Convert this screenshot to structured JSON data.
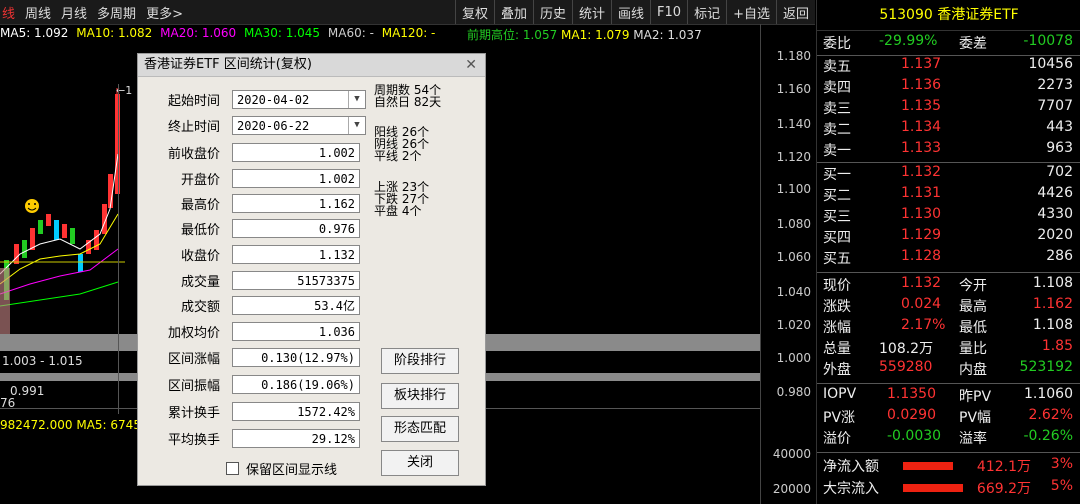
{
  "toolbar": {
    "left": [
      "线",
      "周线",
      "月线",
      "多周期",
      "更多>"
    ],
    "right": [
      "复权",
      "叠加",
      "历史",
      "统计",
      "画线",
      "F10",
      "标记",
      "+自选",
      "返回"
    ]
  },
  "ma": {
    "ma5": "MA5: 1.092",
    "ma10": "MA10: 1.082",
    "ma20": "MA20: 1.060",
    "ma30": "MA30: 1.045",
    "ma60": "MA60: -",
    "ma120": "MA120: -",
    "prev_high": "前期高位: 1.057",
    "ma1": "MA1: 1.079",
    "ma2": "MA2: 1.037"
  },
  "axis_ticks": [
    "1.180",
    "1.160",
    "1.140",
    "1.120",
    "1.100",
    "1.080",
    "1.060",
    "1.040",
    "1.020",
    "1.000",
    "0.980",
    "40000",
    "20000"
  ],
  "chart_labels": {
    "range": "1.003 - 1.015",
    "low": "0.991",
    "low2": "76",
    "vol": "982472.000",
    "vol_ma5": "MA5: 6745"
  },
  "dialog": {
    "title": "香港证券ETF 区间统计(复权)",
    "start_label": "起始时间",
    "start": "2020-04-02",
    "end_label": "终止时间",
    "end": "2020-06-22",
    "fields": [
      {
        "label": "前收盘价",
        "value": "1.002"
      },
      {
        "label": "开盘价",
        "value": "1.002"
      },
      {
        "label": "最高价",
        "value": "1.162"
      },
      {
        "label": "最低价",
        "value": "0.976"
      },
      {
        "label": "收盘价",
        "value": "1.132"
      },
      {
        "label": "成交量",
        "value": "51573375"
      },
      {
        "label": "成交额",
        "value": "53.4亿"
      },
      {
        "label": "加权均价",
        "value": "1.036"
      },
      {
        "label": "区间涨幅",
        "value": "0.130(12.97%)"
      },
      {
        "label": "区间振幅",
        "value": "0.186(19.06%)"
      },
      {
        "label": "累计换手",
        "value": "1572.42%"
      },
      {
        "label": "平均换手",
        "value": "29.12%"
      }
    ],
    "stats": {
      "periods": "周期数 54个",
      "natural_days": "自然日 82天",
      "yang": "阳线 26个",
      "yin": "阴线 26个",
      "flat_line": "平线 2个",
      "up": "上涨 23个",
      "down": "下跌 27个",
      "flat": "平盘 4个"
    },
    "buttons": [
      "阶段排行",
      "板块排行",
      "形态匹配",
      "关闭"
    ],
    "checkbox": "保留区间显示线"
  },
  "quote": {
    "header": "513090 香港证券ETF",
    "weibi_label": "委比",
    "weibi": "-29.99%",
    "weicha_label": "委差",
    "weicha": "-10078",
    "asks": [
      {
        "label": "卖五",
        "price": "1.137",
        "vol": "10456"
      },
      {
        "label": "卖四",
        "price": "1.136",
        "vol": "2273"
      },
      {
        "label": "卖三",
        "price": "1.135",
        "vol": "7707"
      },
      {
        "label": "卖二",
        "price": "1.134",
        "vol": "443"
      },
      {
        "label": "卖一",
        "price": "1.133",
        "vol": "963"
      }
    ],
    "bids": [
      {
        "label": "买一",
        "price": "1.132",
        "vol": "702"
      },
      {
        "label": "买二",
        "price": "1.131",
        "vol": "4426"
      },
      {
        "label": "买三",
        "price": "1.130",
        "vol": "4330"
      },
      {
        "label": "买四",
        "price": "1.129",
        "vol": "2020"
      },
      {
        "label": "买五",
        "price": "1.128",
        "vol": "286"
      }
    ],
    "info": [
      {
        "l1": "现价",
        "v1": "1.132",
        "c1": "red",
        "l2": "今开",
        "v2": "1.108",
        "c2": "wht"
      },
      {
        "l1": "涨跌",
        "v1": "0.024",
        "c1": "red",
        "l2": "最高",
        "v2": "1.162",
        "c2": "red"
      },
      {
        "l1": "涨幅",
        "v1": "2.17%",
        "c1": "red",
        "l2": "最低",
        "v2": "1.108",
        "c2": "wht"
      },
      {
        "l1": "总量",
        "v1": "108.2万",
        "c1": "wht",
        "l2": "量比",
        "v2": "1.85",
        "c2": "red"
      },
      {
        "l1": "外盘",
        "v1": "559280",
        "c1": "red",
        "l2": "内盘",
        "v2": "523192",
        "c2": "grn"
      }
    ],
    "iopv": [
      {
        "l1": "IOPV",
        "v1": "1.1350",
        "c1": "red",
        "l2": "昨PV",
        "v2": "1.1060",
        "c2": "wht"
      },
      {
        "l1": "PV涨",
        "v1": "0.0290",
        "c1": "red",
        "l2": "PV幅",
        "v2": "2.62%",
        "c2": "red"
      },
      {
        "l1": "溢价",
        "v1": "-0.0030",
        "c1": "grn",
        "l2": "溢率",
        "v2": "-0.26%",
        "c2": "grn"
      }
    ],
    "flows": [
      {
        "label": "净流入额",
        "value": "412.1万",
        "pct": "3%"
      },
      {
        "label": "大宗流入",
        "value": "669.2万",
        "pct": "5%"
      }
    ]
  },
  "colors": {
    "up": "#ff3333",
    "down": "#22cc22",
    "ma5": "#ffffff",
    "ma10": "#ffff00",
    "ma20": "#ff00ff",
    "ma30": "#00ff00"
  }
}
